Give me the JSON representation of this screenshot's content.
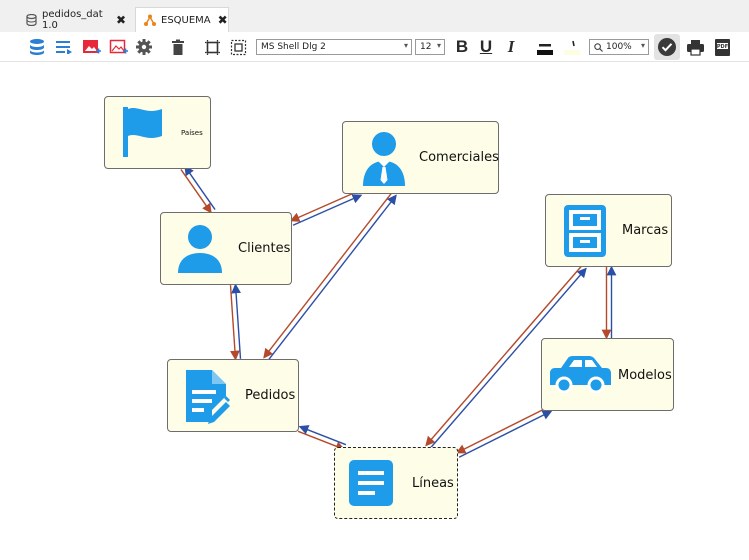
{
  "tabs": [
    {
      "label": "pedidos_dat 1.0",
      "close": "✖",
      "active": false
    },
    {
      "label": "ESQUEMA",
      "close": "✖",
      "active": true
    }
  ],
  "toolbar": {
    "font_name": "MS Shell Dlg 2",
    "font_size": "12",
    "bold_label": "B",
    "underline_label": "U",
    "italic_label": "I",
    "zoom": "100%",
    "dropdown_arrow": "▾"
  },
  "entities": [
    {
      "id": "paises",
      "label": "Países",
      "icon": "flag-icon"
    },
    {
      "id": "comerciales",
      "label": "Comerciales",
      "icon": "person-tie-icon"
    },
    {
      "id": "clientes",
      "label": "Clientes",
      "icon": "person-icon"
    },
    {
      "id": "marcas",
      "label": "Marcas",
      "icon": "cabinet-icon"
    },
    {
      "id": "modelos",
      "label": "Modelos",
      "icon": "car-icon"
    },
    {
      "id": "pedidos",
      "label": "Pedidos",
      "icon": "document-edit-icon"
    },
    {
      "id": "lineas",
      "label": "Líneas",
      "icon": "lines-icon"
    }
  ],
  "relations": [
    [
      "paises",
      "clientes"
    ],
    [
      "comerciales",
      "clientes"
    ],
    [
      "clientes",
      "pedidos"
    ],
    [
      "comerciales",
      "pedidos"
    ],
    [
      "marcas",
      "modelos"
    ],
    [
      "pedidos",
      "lineas"
    ],
    [
      "marcas",
      "lineas"
    ],
    [
      "modelos",
      "lineas"
    ]
  ],
  "colors": {
    "entity_fill": "#fefde8",
    "icon_blue": "#1e9be9",
    "link_blue": "#2c4fa6",
    "link_red": "#b44a2b"
  }
}
